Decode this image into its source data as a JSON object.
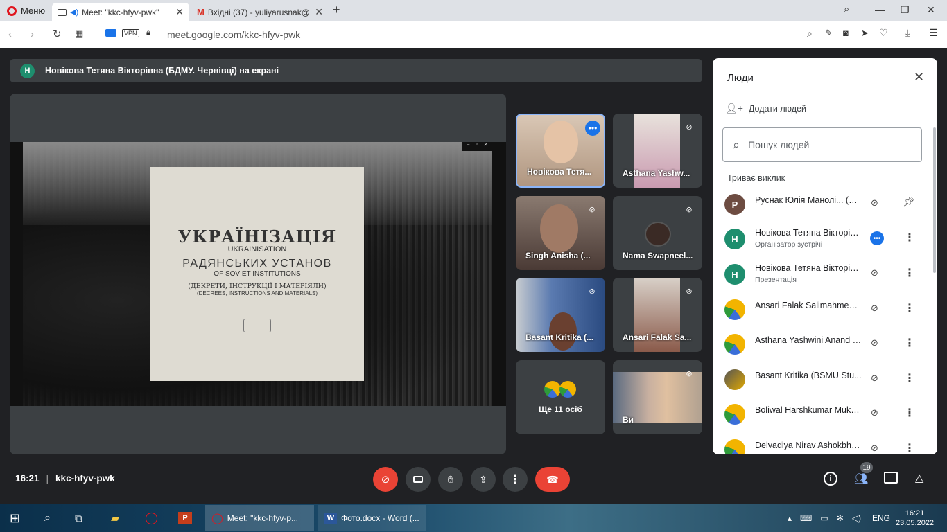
{
  "browser": {
    "menu_label": "Меню",
    "tabs": [
      {
        "title": "Meet: \"kkc-hfyv-pwk\"",
        "active": true
      },
      {
        "title": "Вхідні (37) - yuliyarusnak@",
        "active": false
      }
    ],
    "url": "meet.google.com/kkc-hfyv-pwk",
    "vpn_label": "VPN"
  },
  "meet": {
    "presenting_banner": "Новікова Тетяна Вікторівна (БДМУ. Чернівці) на екрані",
    "presenter_initial": "Н",
    "slide": {
      "title_ua": "УКРАЇНІЗАЦІЯ",
      "title_en": "UKRAINISATION",
      "line2_ua": "РАДЯНСЬКИХ УСТАНОВ",
      "line2_en": "OF SOVIET INSTITUTIONS",
      "line3_ua": "(ДЕКРЕТИ, ІНСТРУКЦІЇ І МАТЕРІЯЛИ)",
      "line3_en": "(DECREES, INSTRUCTIONS AND MATERIALS)"
    },
    "tiles": [
      {
        "name": "Новікова Тетя..."
      },
      {
        "name": "Asthana Yashw..."
      },
      {
        "name": "Singh Anisha (..."
      },
      {
        "name": "Nama Swapneel..."
      },
      {
        "name": "Basant Kritika (..."
      },
      {
        "name": "Ansari Falak Sa..."
      },
      {
        "name": "Ще 11 осіб"
      },
      {
        "name": "Ви"
      }
    ],
    "meeting_time": "16:21",
    "meeting_code": "kkc-hfyv-pwk",
    "participants_count": "19",
    "colors": {
      "bg": "#202124",
      "tile": "#3c4043",
      "end_call": "#ea4335",
      "accent": "#1a73e8"
    }
  },
  "people_panel": {
    "title": "Люди",
    "add_people": "Додати людей",
    "search_placeholder": "Пошук людей",
    "section": "Триває виклик",
    "participants": [
      {
        "initial": "Р",
        "name": "Руснак Юлія Манолі... (Ви)",
        "sub": ""
      },
      {
        "initial": "Н",
        "name": "Новікова Тетяна Вікторів...",
        "sub": "Організатор зустрічі"
      },
      {
        "initial": "Н",
        "name": "Новікова Тетяна Вікторів...",
        "sub": "Презентація"
      },
      {
        "initial": "",
        "name": "Ansari Falak Salimahmed ...",
        "sub": ""
      },
      {
        "initial": "",
        "name": "Asthana Yashwini Anand (...",
        "sub": ""
      },
      {
        "initial": "",
        "name": "Basant Kritika (BSMU Stu...",
        "sub": ""
      },
      {
        "initial": "",
        "name": "Boliwal Harshkumar Muke...",
        "sub": ""
      },
      {
        "initial": "",
        "name": "Delvadiya Nirav Ashokbha...",
        "sub": ""
      }
    ]
  },
  "taskbar": {
    "items": [
      {
        "label": "Meet: \"kkc-hfyv-p..."
      },
      {
        "label": "Фото.docx - Word (..."
      }
    ],
    "lang": "ENG",
    "time": "16:21",
    "date": "23.05.2022"
  }
}
